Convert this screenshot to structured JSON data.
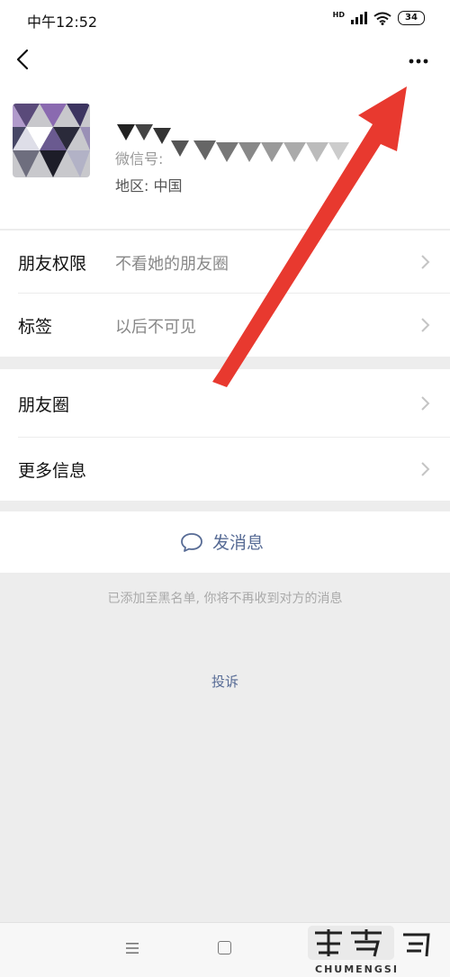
{
  "status_bar": {
    "time": "中午12:52",
    "signal_label": "HD",
    "battery": "34"
  },
  "profile": {
    "wxid_label": "微信号:",
    "region": "地区: 中国"
  },
  "rows": {
    "permission": {
      "title": "朋友权限",
      "value": "不看她的朋友圈"
    },
    "tags": {
      "title": "标签",
      "value": "以后不可见"
    },
    "moments": {
      "title": "朋友圈"
    },
    "more_info": {
      "title": "更多信息"
    }
  },
  "actions": {
    "send_message": "发消息"
  },
  "notice": "已添加至黑名单, 你将不再收到对方的消息",
  "complain": "投诉",
  "watermark": {
    "text": "CHUMENGSI"
  },
  "colors": {
    "link": "#576b95",
    "arrow": "#e8392f",
    "background": "#ededed"
  }
}
